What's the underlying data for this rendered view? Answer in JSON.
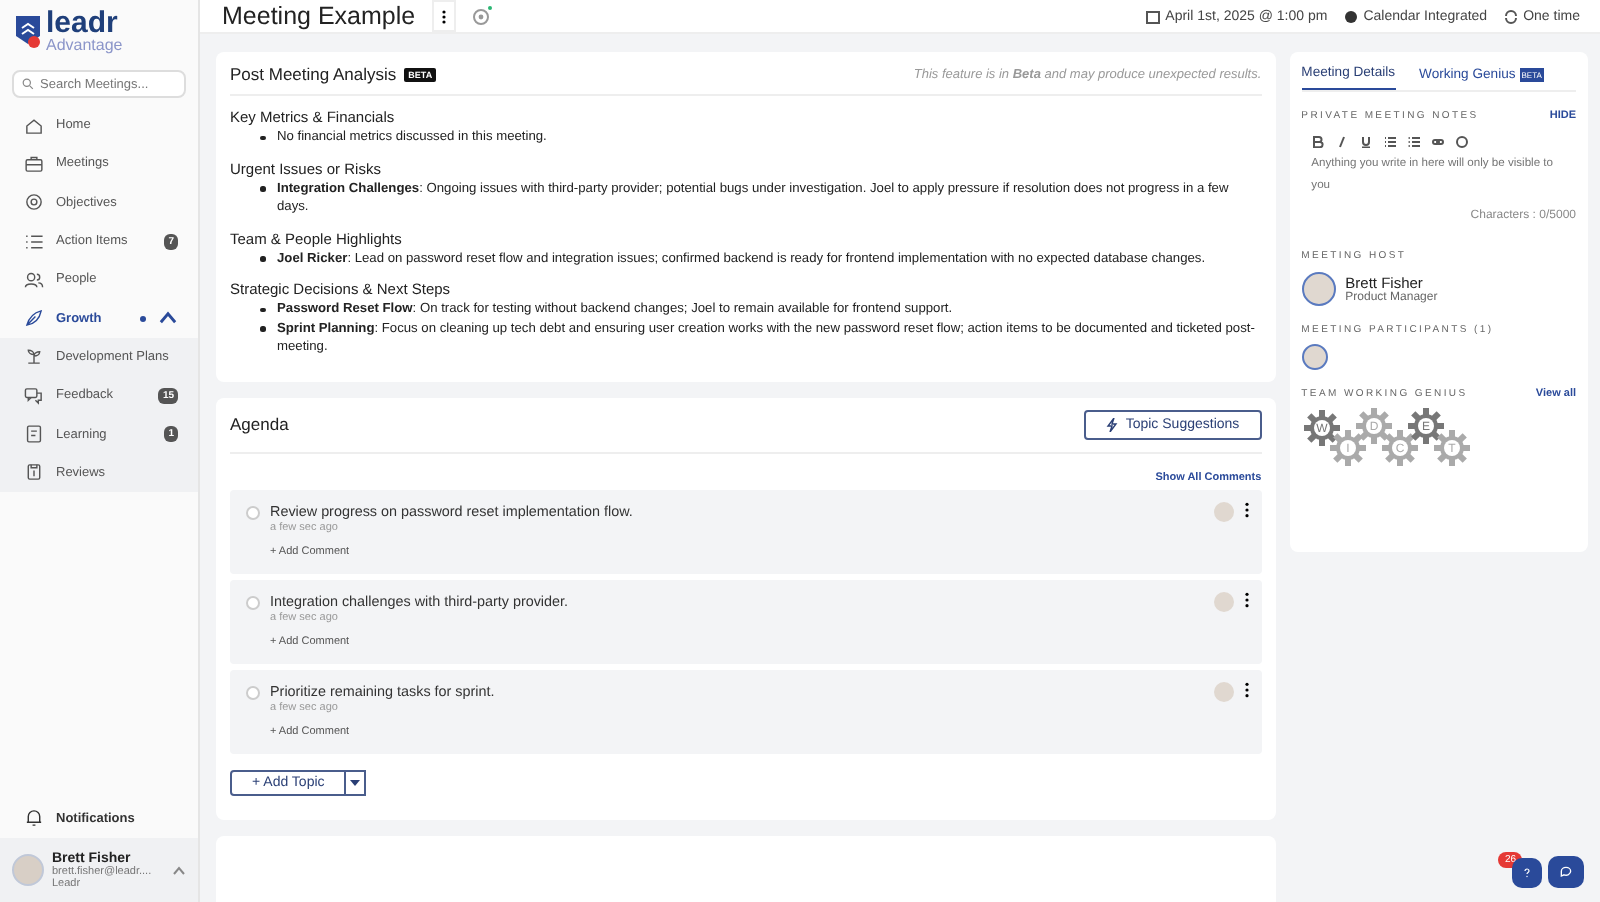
{
  "sidebar": {
    "logo": {
      "name": "leadr",
      "sub": "Advantage"
    },
    "search": {
      "placeholder": "Search Meetings..."
    },
    "items": [
      {
        "label": "Home",
        "selected": false
      },
      {
        "label": "Meetings",
        "selected": false
      },
      {
        "label": "Objectives",
        "selected": false
      },
      {
        "label": "Action Items",
        "badge": "7",
        "selected": false
      },
      {
        "label": "People",
        "selected": false
      },
      {
        "label": "Growth",
        "selected": true,
        "expanded": true,
        "children": [
          {
            "label": "Development Plans",
            "selected": false
          },
          {
            "label": "Feedback",
            "badge": "15",
            "selected": false
          },
          {
            "label": "Learning",
            "badge": "1",
            "selected": false
          },
          {
            "label": "Reviews",
            "selected": false
          }
        ]
      }
    ],
    "notifications": "Notifications",
    "user": {
      "name": "Brett Fisher",
      "email": "brett.fisher@leadr....",
      "org": "Leadr"
    }
  },
  "header": {
    "title": "Meeting Example",
    "date": "April 1st, 2025 @ 1:00 pm",
    "calendar": "Calendar Integrated",
    "recurrence": "One time"
  },
  "analysis": {
    "title": "Post Meeting Analysis",
    "badge": "BETA",
    "note": "This feature is in **Beta** and may produce unexpected results.",
    "sections": [
      {
        "heading": "Key Metrics & Financials",
        "bullets": [
          "No financial metrics discussed in this meeting."
        ]
      },
      {
        "heading": "Urgent Issues or Risks",
        "bullets": [
          "**Integration Challenges**: Ongoing issues with third-party provider; potential bugs under investigation. Joel to apply pressure if resolution does not progress in a few days."
        ]
      },
      {
        "heading": "Team & People Highlights",
        "bullets": [
          "**Joel Ricker**: Lead on password reset flow and integration issues; confirmed backend is ready for frontend implementation with no expected database changes."
        ]
      },
      {
        "heading": "Strategic Decisions & Next Steps",
        "bullets": [
          "**Password Reset Flow**: On track for testing without backend changes; Joel to remain available for frontend support.",
          "**Sprint Planning**: Focus on cleaning up tech debt and ensuring user creation works with the new password reset flow; action items to be documented and ticketed post-meeting."
        ]
      }
    ]
  },
  "agenda": {
    "title": "Agenda",
    "suggestions": "Topic Suggestions",
    "show_all": "Show All Comments",
    "topics": [
      {
        "text": "Review progress on password reset implementation flow.",
        "time": "a few sec ago",
        "add_comment": "+ Add Comment",
        "checked": false
      },
      {
        "text": "Integration challenges with third-party provider.",
        "time": "a few sec ago",
        "add_comment": "+ Add Comment",
        "checked": false
      },
      {
        "text": "Prioritize remaining tasks for sprint.",
        "time": "a few sec ago",
        "add_comment": "+ Add Comment",
        "checked": false
      }
    ],
    "add_topic": "+ Add Topic"
  },
  "details": {
    "tabs": [
      {
        "label": "Meeting Details",
        "selected": true
      },
      {
        "label": "Working Genius",
        "selected": false,
        "badge": "BETA"
      }
    ],
    "notes_label": "PRIVATE MEETING NOTES",
    "hide": "HIDE",
    "notes_placeholder": "Anything you write in here will only be visible to you",
    "chars": "Characters : 0/5000",
    "host_label": "MEETING HOST",
    "host": {
      "name": "Brett Fisher",
      "role": "Product Manager"
    },
    "participants_label": "MEETING PARTICIPANTS (1)",
    "genius_label": "TEAM WORKING GENIUS",
    "view_all": "View all",
    "genius": [
      "W",
      "I",
      "D",
      "C",
      "E",
      "T"
    ]
  },
  "help_badge": "26"
}
